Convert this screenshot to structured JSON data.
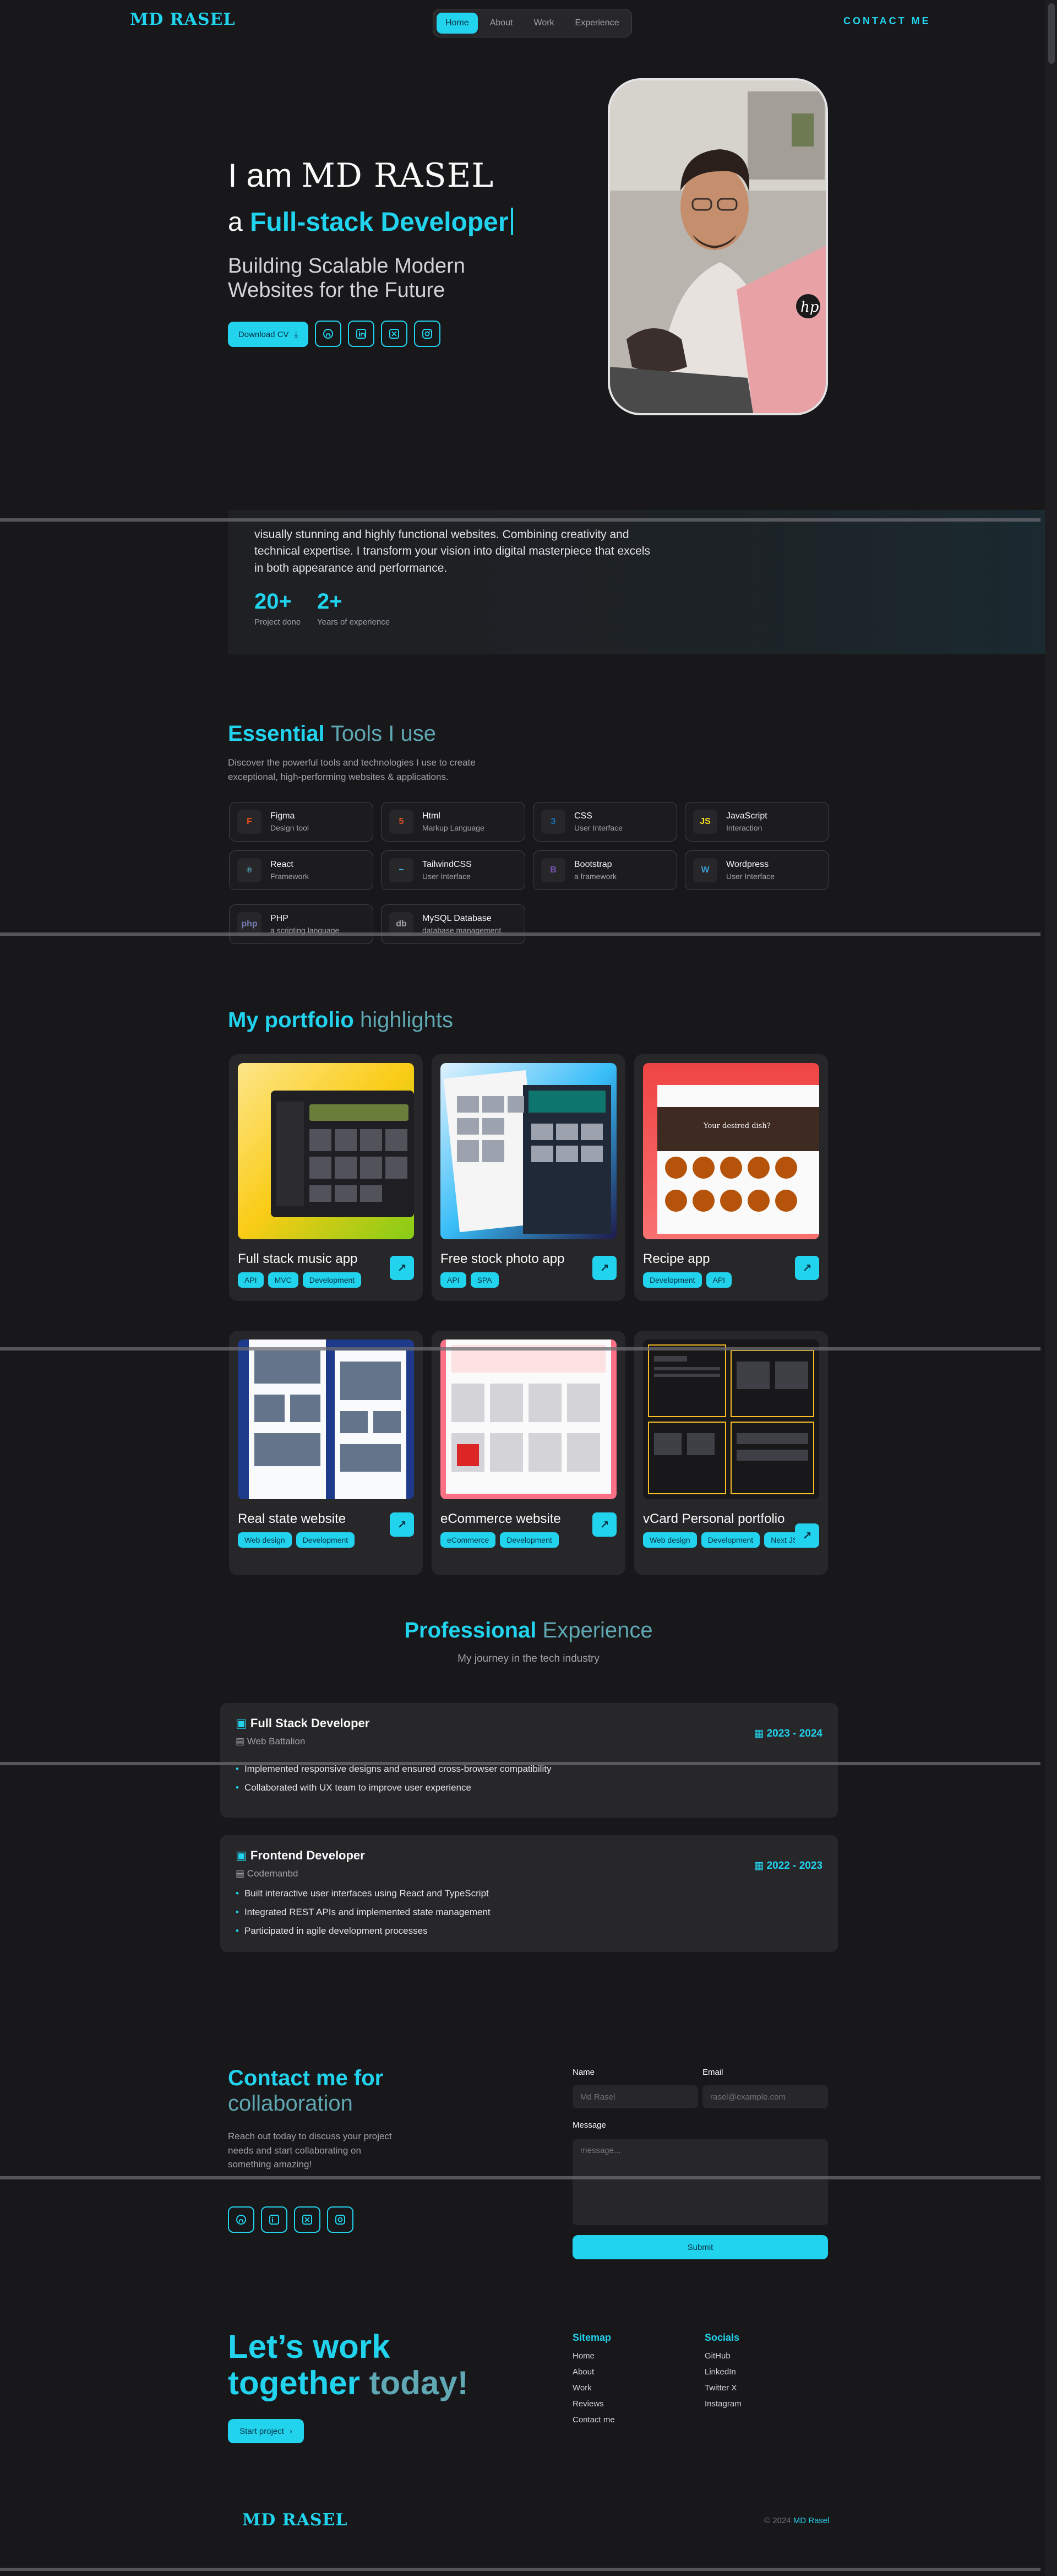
{
  "nav": {
    "logo": "MD RASEL",
    "items": [
      "Home",
      "About",
      "Work",
      "Experience"
    ],
    "active": "Home",
    "contact": "CONTACT ME"
  },
  "hero": {
    "greeting": "I am",
    "name": "MD RASEL",
    "prefix": "a",
    "role": "Full-stack Developer",
    "subtitle_line1": "Building Scalable Modern",
    "subtitle_line2": "Websites for the Future",
    "download_label": "Download CV",
    "social_icons": [
      "github-icon",
      "linkedin-icon",
      "twitter-x-icon",
      "instagram-icon"
    ]
  },
  "about": {
    "line1": "visually stunning and highly functional websites. Combining creativity and",
    "line2": "technical expertise. I transform your vision into digital masterpiece that excels",
    "line3": "in both appearance and performance.",
    "stats": [
      {
        "num": "20+",
        "label": "Project done"
      },
      {
        "num": "2+",
        "label": "Years of experience"
      }
    ]
  },
  "tools": {
    "title_a": "Essential",
    "title_b": "Tools I use",
    "desc_line1": "Discover the powerful tools and technologies I use to create",
    "desc_line2": "exceptional, high-performing websites & applications.",
    "items": [
      {
        "name": "Figma",
        "sub": "Design tool",
        "glyph": "F",
        "color": "#f24e1e"
      },
      {
        "name": "Html",
        "sub": "Markup Language",
        "glyph": "5",
        "color": "#e34f26"
      },
      {
        "name": "CSS",
        "sub": "User Interface",
        "glyph": "3",
        "color": "#1572b6"
      },
      {
        "name": "JavaScript",
        "sub": "Interaction",
        "glyph": "JS",
        "color": "#f7df1e"
      },
      {
        "name": "React",
        "sub": "Framework",
        "glyph": "⚛",
        "color": "#61dafb"
      },
      {
        "name": "TailwindCSS",
        "sub": "User Interface",
        "glyph": "~",
        "color": "#38bdf8"
      },
      {
        "name": "Bootstrap",
        "sub": "a framework",
        "glyph": "B",
        "color": "#7952b3"
      },
      {
        "name": "Wordpress",
        "sub": "User Interface",
        "glyph": "W",
        "color": "#3a9bd5"
      },
      {
        "name": "PHP",
        "sub": "a scripting language",
        "glyph": "php",
        "color": "#777bb4"
      },
      {
        "name": "MySQL Database",
        "sub": "database management",
        "glyph": "db",
        "color": "#a1a1aa"
      }
    ]
  },
  "portfolio": {
    "title_a": "My portfolio",
    "title_b": "highlights",
    "items": [
      {
        "title": "Full stack music app",
        "tags": [
          "API",
          "MVC",
          "Development"
        ]
      },
      {
        "title": "Free stock photo app",
        "tags": [
          "API",
          "SPA"
        ]
      },
      {
        "title": "Recipe app",
        "tags": [
          "Development",
          "API"
        ]
      },
      {
        "title": "Real state website",
        "tags": [
          "Web design",
          "Development"
        ]
      },
      {
        "title": "eCommerce website",
        "tags": [
          "eCommerce",
          "Development"
        ]
      },
      {
        "title": "vCard Personal portfolio",
        "tags": [
          "Web design",
          "Development",
          "Next JS"
        ]
      }
    ],
    "recipe_search": "Your desired dish?"
  },
  "experience": {
    "title_a": "Professional",
    "title_b": "Experience",
    "subtitle": "My journey in the tech industry",
    "jobs": [
      {
        "role": "Full Stack Developer",
        "company": "Web Battalion",
        "years": "2023 - 2024",
        "bullets": [
          "Implemented responsive designs and ensured cross-browser compatibility",
          "Collaborated with UX team to improve user experience"
        ]
      },
      {
        "role": "Frontend Developer",
        "company": "Codemanbd",
        "years": "2022 - 2023",
        "bullets": [
          "Built interactive user interfaces using React and TypeScript",
          "Integrated REST APIs and implemented state management",
          "Participated in agile development processes"
        ]
      }
    ]
  },
  "contact": {
    "title_a": "Contact me for",
    "title_b": "collaboration",
    "desc_line1": "Reach out today to discuss your project",
    "desc_line2": "needs and start collaborating on",
    "desc_line3": "something amazing!",
    "name_label": "Name",
    "name_placeholder": "Md Rasel",
    "email_label": "Email",
    "email_placeholder": "rasel@example.com",
    "message_label": "Message",
    "message_placeholder": "message...",
    "submit": "Submit"
  },
  "footer": {
    "cta_line1": "Let’s work",
    "cta_line2a": "together",
    "cta_line2b": "today!",
    "start_project": "Start project",
    "sitemap_title": "Sitemap",
    "sitemap": [
      "Home",
      "About",
      "Work",
      "Reviews",
      "Contact me"
    ],
    "socials_title": "Socials",
    "socials": [
      "GitHub",
      "LinkedIn",
      "Twitter X",
      "Instagram"
    ],
    "copyright_prefix": "© 2024",
    "copyright_name": "MD Rasel",
    "logo": "MD RASEL"
  }
}
